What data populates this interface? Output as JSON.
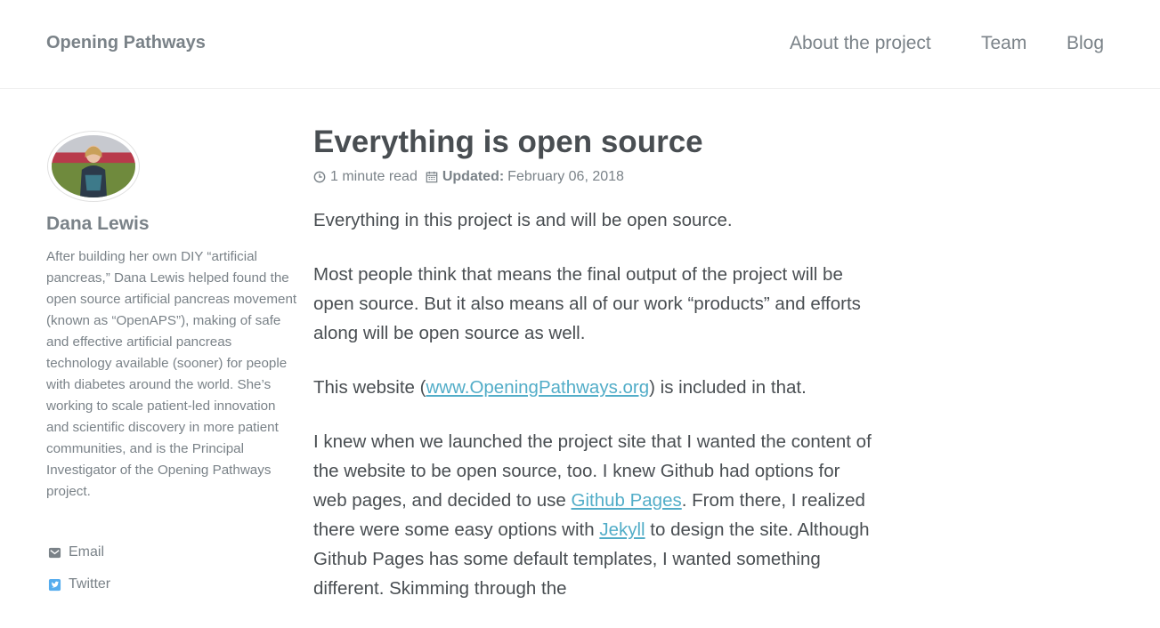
{
  "header": {
    "site_title": "Opening Pathways",
    "nav": [
      {
        "label": "About the project"
      },
      {
        "label": "Team"
      },
      {
        "label": "Blog"
      }
    ]
  },
  "author": {
    "name": "Dana Lewis",
    "bio": "After building her own DIY “artificial pancreas,” Dana Lewis helped found the open source artificial pancreas movement (known as “OpenAPS”), making of safe and effective artificial pancreas technology available (sooner) for people with diabetes around the world. She’s working to scale patient-led innovation and scientific discovery in more patient communities, and is the Principal Investigator of the Opening Pathways project.",
    "links": [
      {
        "label": "Email",
        "icon": "envelope-icon"
      },
      {
        "label": "Twitter",
        "icon": "twitter-icon"
      }
    ]
  },
  "post": {
    "title": "Everything is open source",
    "read_time": "1 minute read",
    "updated_label": "Updated:",
    "updated_date": "February 06, 2018",
    "p1": "Everything in this project is and will be open source.",
    "p2": "Most people think that means the final output of the project will be open source. But it also means all of our work “products” and efforts along will be open source as well.",
    "p3_before": "This website (",
    "p3_link": "www.OpeningPathways.org",
    "p3_after": ") is included in that.",
    "p4_a": "I knew when we launched the project site that I wanted the content of the website to be open source, too. I knew Github had options for web pages, and decided to use ",
    "p4_link1": "Github Pages",
    "p4_b": ". From there, I realized there were some easy options with ",
    "p4_link2": "Jekyll",
    "p4_c": " to design the site. Although Github Pages has some default templates, I wanted something different. Skimming through the"
  },
  "colors": {
    "link": "#52adc8",
    "muted": "#7a8288",
    "text": "#494e52"
  }
}
